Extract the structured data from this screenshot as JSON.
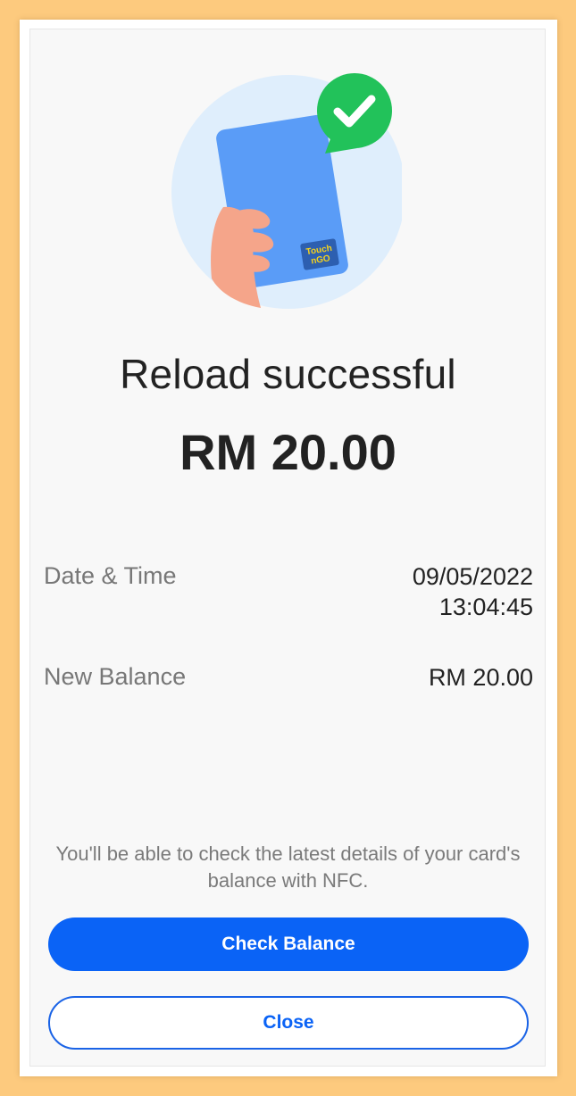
{
  "card_logo": {
    "line1": "Touch",
    "line2": "nGO"
  },
  "result": {
    "title": "Reload successful",
    "amount": "RM 20.00"
  },
  "details": {
    "datetime_label": "Date & Time",
    "date": "09/05/2022",
    "time": "13:04:45",
    "balance_label": "New Balance",
    "balance_value": "RM 20.00"
  },
  "note": "You'll be able to check the latest details of your card's balance with NFC.",
  "buttons": {
    "check_balance": "Check Balance",
    "close": "Close"
  },
  "icons": {
    "success": "check-badge-icon",
    "card": "tng-card-illustration"
  },
  "colors": {
    "accent": "#0a63f6",
    "success": "#22c25a",
    "background": "#fdca7e"
  }
}
